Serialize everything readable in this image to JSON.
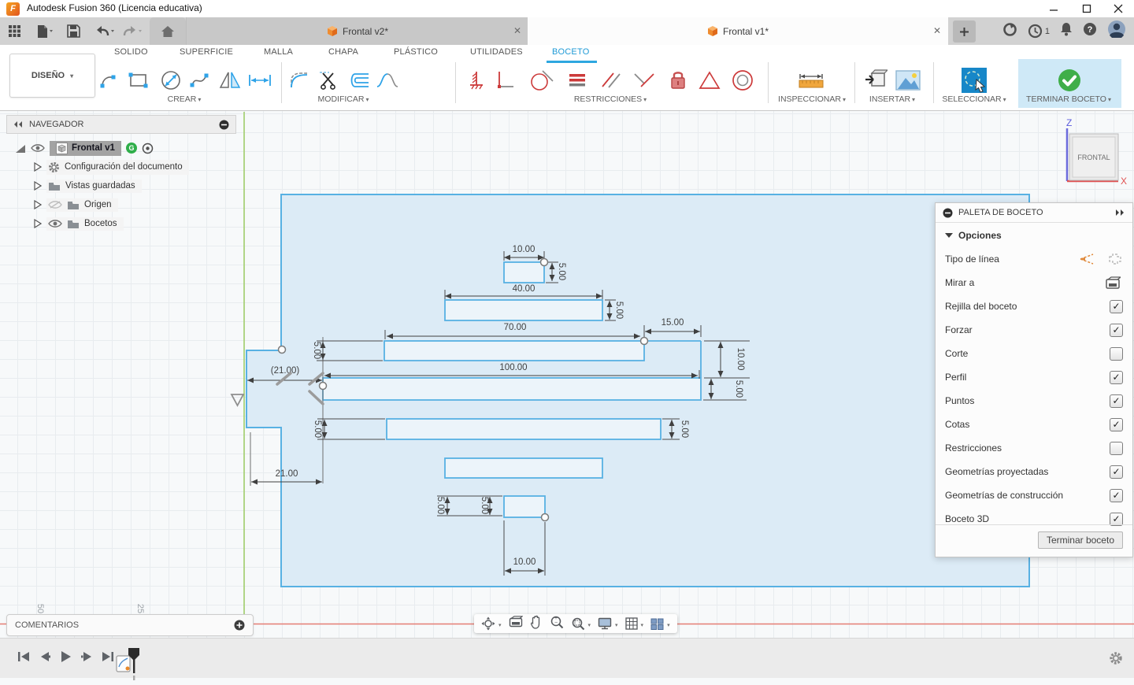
{
  "window": {
    "title": "Autodesk Fusion 360 (Licencia educativa)"
  },
  "tabbar": {
    "tabs": [
      {
        "label": "Frontal v2*"
      },
      {
        "label": "Frontal v1*"
      }
    ],
    "notification_count": "1"
  },
  "ribbon": {
    "design_button": "DISEÑO",
    "tabs": [
      {
        "label": "SOLIDO"
      },
      {
        "label": "SUPERFICIE"
      },
      {
        "label": "MALLA"
      },
      {
        "label": "CHAPA"
      },
      {
        "label": "PLÁSTICO"
      },
      {
        "label": "UTILIDADES"
      },
      {
        "label": "BOCETO",
        "active": true
      }
    ],
    "groups": [
      {
        "label": "CREAR"
      },
      {
        "label": "MODIFICAR"
      },
      {
        "label": "RESTRICCIONES"
      },
      {
        "label": "INSPECCIONAR"
      },
      {
        "label": "INSERTAR"
      },
      {
        "label": "SELECCIONAR"
      },
      {
        "label": "TERMINAR BOCETO"
      }
    ]
  },
  "navigator": {
    "title": "NAVEGADOR",
    "root": {
      "label": "Frontal v1",
      "badge": "G"
    },
    "items": [
      {
        "label": "Configuración del documento"
      },
      {
        "label": "Vistas guardadas"
      },
      {
        "label": "Origen"
      },
      {
        "label": "Bocetos"
      }
    ]
  },
  "palette": {
    "title": "PALETA DE BOCETO",
    "section": "Opciones",
    "options": [
      {
        "label": "Tipo de línea",
        "control": "icons"
      },
      {
        "label": "Mirar a",
        "control": "icon"
      },
      {
        "label": "Rejilla del boceto",
        "checked": true
      },
      {
        "label": "Forzar",
        "checked": true
      },
      {
        "label": "Corte",
        "checked": false
      },
      {
        "label": "Perfil",
        "checked": true
      },
      {
        "label": "Puntos",
        "checked": true
      },
      {
        "label": "Cotas",
        "checked": true
      },
      {
        "label": "Restricciones",
        "checked": false
      },
      {
        "label": "Geometrías proyectadas",
        "checked": true
      },
      {
        "label": "Geometrías de construcción",
        "checked": true
      },
      {
        "label": "Boceto 3D",
        "checked": true
      }
    ],
    "footer_button": "Terminar boceto"
  },
  "viewcube": {
    "face": "FRONTAL",
    "axis_z": "Z",
    "axis_x": "X"
  },
  "comments": {
    "label": "COMENTARIOS"
  },
  "canvas": {
    "sketch_line_color": "#58b1e3",
    "profile_fill": "#dcebf6",
    "dims": [
      {
        "id": "top-width",
        "value": "10.00"
      },
      {
        "id": "top-height",
        "value": "5.00"
      },
      {
        "id": "slot40-width",
        "value": "40.00"
      },
      {
        "id": "slot40-height",
        "value": "5.00"
      },
      {
        "id": "slot70-width",
        "value": "70.00"
      },
      {
        "id": "step-width",
        "value": "15.00"
      },
      {
        "id": "slot70-height",
        "value": "5.00"
      },
      {
        "id": "step-height",
        "value": "10.00"
      },
      {
        "id": "slot100-width",
        "value": "100.00"
      },
      {
        "id": "notch-ref-width",
        "value": "(21.00)"
      },
      {
        "id": "slot100-height",
        "value": "5.00"
      },
      {
        "id": "slotE-height-left",
        "value": "5.00"
      },
      {
        "id": "slotE-height-right",
        "value": "5.00"
      },
      {
        "id": "notch-width",
        "value": "21.00"
      },
      {
        "id": "slotG-height-1",
        "value": "5.00"
      },
      {
        "id": "slotG-height-2",
        "value": "5.00"
      },
      {
        "id": "bottom-width",
        "value": "10.00"
      }
    ],
    "rulers": [
      {
        "value": "50"
      },
      {
        "value": "25"
      }
    ]
  }
}
